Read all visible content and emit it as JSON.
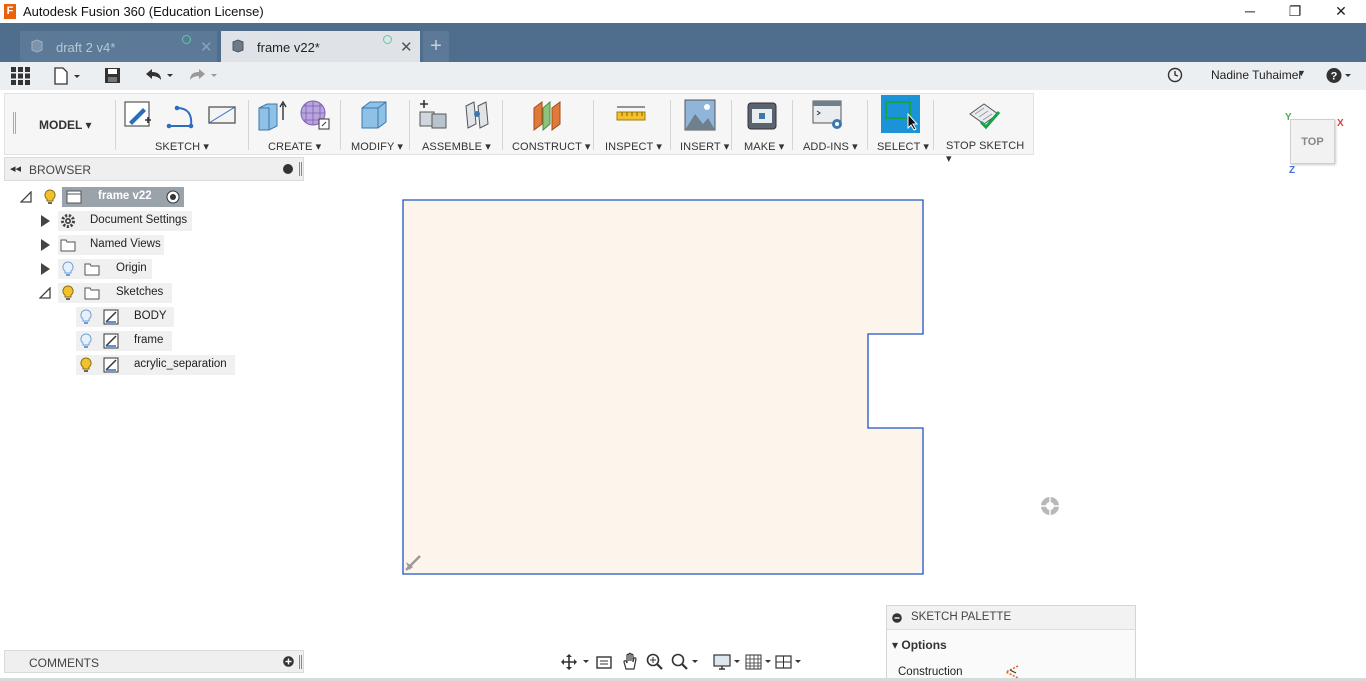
{
  "window": {
    "title": "Autodesk Fusion 360 (Education License)",
    "logo_letter": "F",
    "controls": {
      "minimize": "─",
      "restore": "❐",
      "close": "✕"
    }
  },
  "tabs": [
    {
      "label": "draft 2 v4*",
      "active": false
    },
    {
      "label": "frame v22*",
      "active": true
    }
  ],
  "new_tab_label": "+",
  "quick_access": {
    "user": "Nadine Tuhaimer",
    "help": "?"
  },
  "toolbar": {
    "workspace": "MODEL",
    "groups": [
      {
        "label": "SKETCH"
      },
      {
        "label": "CREATE"
      },
      {
        "label": "MODIFY"
      },
      {
        "label": "ASSEMBLE"
      },
      {
        "label": "CONSTRUCT"
      },
      {
        "label": "INSPECT"
      },
      {
        "label": "INSERT"
      },
      {
        "label": "MAKE"
      },
      {
        "label": "ADD-INS"
      },
      {
        "label": "SELECT"
      },
      {
        "label": "STOP SKETCH"
      }
    ],
    "dropdown_caret": "▾"
  },
  "browser": {
    "title": "BROWSER",
    "root": "frame v22",
    "items": [
      {
        "label": "Document Settings"
      },
      {
        "label": "Named Views"
      },
      {
        "label": "Origin"
      },
      {
        "label": "Sketches"
      }
    ],
    "sketches": [
      {
        "label": "BODY",
        "visible": false
      },
      {
        "label": "frame",
        "visible": false
      },
      {
        "label": "acrylic_separation",
        "visible": true
      }
    ]
  },
  "viewcube": {
    "face": "TOP",
    "axes": {
      "x": "X",
      "y": "Y",
      "z": "Z"
    }
  },
  "comments": {
    "title": "COMMENTS"
  },
  "sketch_palette": {
    "title": "SKETCH PALETTE",
    "section": "Options",
    "option": "Construction"
  },
  "colors": {
    "tab_bar": "#4f6e8e",
    "sketch_fill": "#fdf5ec",
    "sketch_line": "#1f55c6",
    "select_active": "#1a94d6",
    "bulb_on": "#f2c12e",
    "bulb_off": "#9fc3e8"
  }
}
